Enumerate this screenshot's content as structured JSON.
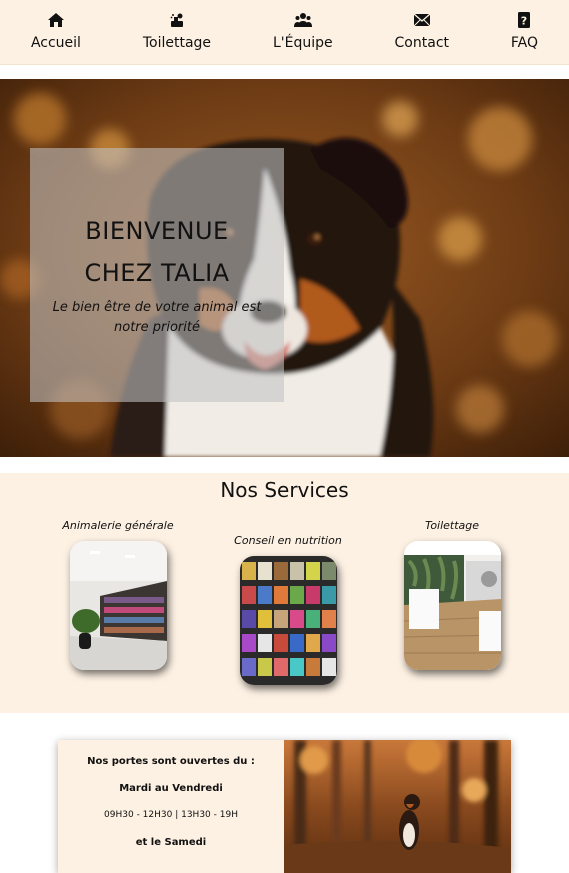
{
  "nav": {
    "items": [
      {
        "label": "Accueil",
        "icon": "home-icon"
      },
      {
        "label": "Toilettage",
        "icon": "grooming-icon"
      },
      {
        "label": "L'Équipe",
        "icon": "team-icon"
      },
      {
        "label": "Contact",
        "icon": "envelope-icon"
      },
      {
        "label": "FAQ",
        "icon": "question-icon"
      }
    ],
    "background": "#fdf1e3"
  },
  "hero": {
    "title_line1": "BIENVENUE",
    "title_line2": "CHEZ TALIA",
    "subtitle": "Le bien être de votre animal est notre priorité"
  },
  "services": {
    "heading": "Nos Services",
    "items": [
      {
        "caption": "Animalerie générale"
      },
      {
        "caption": "Conseil en nutrition"
      },
      {
        "caption": "Toilettage"
      }
    ]
  },
  "hours": {
    "intro": "Nos portes sont ouvertes du :",
    "weekdays": "Mardi au Vendredi",
    "weekday_times": "09H30 - 12H30 | 13H30 - 19H",
    "saturday": "et le Samedi"
  },
  "colors": {
    "cream": "#fdf1e3",
    "text": "#111111"
  }
}
